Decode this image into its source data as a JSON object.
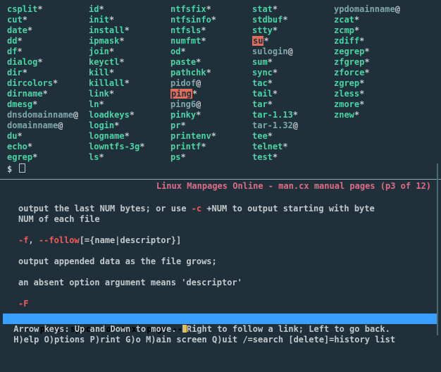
{
  "columns": [
    [
      {
        "name": "csplit",
        "suffix": "*",
        "style": "exe"
      },
      {
        "name": "cut",
        "suffix": "*",
        "style": "exe"
      },
      {
        "name": "date",
        "suffix": "*",
        "style": "exe"
      },
      {
        "name": "dd",
        "suffix": "*",
        "style": "exe"
      },
      {
        "name": "df",
        "suffix": "*",
        "style": "exe"
      },
      {
        "name": "dialog",
        "suffix": "*",
        "style": "exe"
      },
      {
        "name": "dir",
        "suffix": "*",
        "style": "exe"
      },
      {
        "name": "dircolors",
        "suffix": "*",
        "style": "exe"
      },
      {
        "name": "dirname",
        "suffix": "*",
        "style": "exe"
      },
      {
        "name": "dmesg",
        "suffix": "*",
        "style": "exe"
      },
      {
        "name": "dnsdomainname",
        "suffix": "@",
        "style": "link"
      },
      {
        "name": "domainname",
        "suffix": "@",
        "style": "link"
      },
      {
        "name": "du",
        "suffix": "*",
        "style": "exe"
      },
      {
        "name": "echo",
        "suffix": "*",
        "style": "exe"
      },
      {
        "name": "egrep",
        "suffix": "*",
        "style": "exe"
      }
    ],
    [
      {
        "name": "id",
        "suffix": "*",
        "style": "exe"
      },
      {
        "name": "init",
        "suffix": "*",
        "style": "exe"
      },
      {
        "name": "install",
        "suffix": "*",
        "style": "exe"
      },
      {
        "name": "ipmask",
        "suffix": "*",
        "style": "exe"
      },
      {
        "name": "join",
        "suffix": "*",
        "style": "exe"
      },
      {
        "name": "keyctl",
        "suffix": "*",
        "style": "exe"
      },
      {
        "name": "kill",
        "suffix": "*",
        "style": "exe"
      },
      {
        "name": "killall",
        "suffix": "*",
        "style": "exe"
      },
      {
        "name": "link",
        "suffix": "*",
        "style": "exe"
      },
      {
        "name": "ln",
        "suffix": "*",
        "style": "exe"
      },
      {
        "name": "loadkeys",
        "suffix": "*",
        "style": "exe"
      },
      {
        "name": "login",
        "suffix": "*",
        "style": "exe"
      },
      {
        "name": "logname",
        "suffix": "*",
        "style": "exe"
      },
      {
        "name": "lowntfs-3g",
        "suffix": "*",
        "style": "exe"
      },
      {
        "name": "ls",
        "suffix": "*",
        "style": "exe"
      }
    ],
    [
      {
        "name": "ntfsfix",
        "suffix": "*",
        "style": "exe"
      },
      {
        "name": "ntfsinfo",
        "suffix": "*",
        "style": "exe"
      },
      {
        "name": "ntfsls",
        "suffix": "*",
        "style": "exe"
      },
      {
        "name": "numfmt",
        "suffix": "*",
        "style": "exe"
      },
      {
        "name": "od",
        "suffix": "*",
        "style": "exe"
      },
      {
        "name": "paste",
        "suffix": "*",
        "style": "exe"
      },
      {
        "name": "pathchk",
        "suffix": "*",
        "style": "exe"
      },
      {
        "name": "pidof",
        "suffix": "@",
        "style": "link"
      },
      {
        "name": "ping",
        "suffix": "*",
        "style": "exe",
        "bg": "red"
      },
      {
        "name": "ping6",
        "suffix": "@",
        "style": "link"
      },
      {
        "name": "pinky",
        "suffix": "*",
        "style": "exe"
      },
      {
        "name": "pr",
        "suffix": "*",
        "style": "exe"
      },
      {
        "name": "printenv",
        "suffix": "*",
        "style": "exe"
      },
      {
        "name": "printf",
        "suffix": "*",
        "style": "exe"
      },
      {
        "name": "ps",
        "suffix": "*",
        "style": "exe"
      }
    ],
    [
      {
        "name": "stat",
        "suffix": "*",
        "style": "exe"
      },
      {
        "name": "stdbuf",
        "suffix": "*",
        "style": "exe"
      },
      {
        "name": "stty",
        "suffix": "*",
        "style": "exe"
      },
      {
        "name": "su",
        "suffix": "*",
        "style": "exe",
        "bg": "red"
      },
      {
        "name": "sulogin",
        "suffix": "@",
        "style": "link"
      },
      {
        "name": "sum",
        "suffix": "*",
        "style": "exe"
      },
      {
        "name": "sync",
        "suffix": "*",
        "style": "exe"
      },
      {
        "name": "tac",
        "suffix": "*",
        "style": "exe"
      },
      {
        "name": "tail",
        "suffix": "*",
        "style": "exe"
      },
      {
        "name": "tar",
        "suffix": "*",
        "style": "exe"
      },
      {
        "name": "tar-1.13",
        "suffix": "*",
        "style": "exe"
      },
      {
        "name": "tar-1.32",
        "suffix": "@",
        "style": "link"
      },
      {
        "name": "tee",
        "suffix": "*",
        "style": "exe"
      },
      {
        "name": "telnet",
        "suffix": "*",
        "style": "exe"
      },
      {
        "name": "test",
        "suffix": "*",
        "style": "exe"
      }
    ],
    [
      {
        "name": "ypdomainname",
        "suffix": "@",
        "style": "link"
      },
      {
        "name": "zcat",
        "suffix": "*",
        "style": "exe"
      },
      {
        "name": "zcmp",
        "suffix": "*",
        "style": "exe"
      },
      {
        "name": "zdiff",
        "suffix": "*",
        "style": "exe"
      },
      {
        "name": "zegrep",
        "suffix": "*",
        "style": "exe"
      },
      {
        "name": "zfgrep",
        "suffix": "*",
        "style": "exe"
      },
      {
        "name": "zforce",
        "suffix": "*",
        "style": "exe"
      },
      {
        "name": "zgrep",
        "suffix": "*",
        "style": "exe"
      },
      {
        "name": "zless",
        "suffix": "*",
        "style": "exe"
      },
      {
        "name": "zmore",
        "suffix": "*",
        "style": "exe"
      },
      {
        "name": "znew",
        "suffix": "*",
        "style": "exe"
      }
    ]
  ],
  "prompt_symbol": "$",
  "title_line": "Linux Manpages Online - man.cx manual pages (p3 of 12)",
  "man_lines": [
    {
      "type": "blank"
    },
    {
      "type": "text",
      "text": "output the last NUM bytes; or use ",
      "opt": "-c",
      "tail": " +NUM to output starting with byte"
    },
    {
      "type": "text",
      "text": "NUM of each file"
    },
    {
      "type": "blank"
    },
    {
      "type": "optline",
      "opt": "-f",
      "sep": ", ",
      "opt2": "--follow",
      "tail": "[={name|descriptor}]"
    },
    {
      "type": "blank"
    },
    {
      "type": "text",
      "text": "output appended data as the file grows;"
    },
    {
      "type": "blank"
    },
    {
      "type": "text",
      "text": "an absent option argument means 'descriptor'"
    },
    {
      "type": "blank"
    },
    {
      "type": "optline",
      "opt": "-F"
    }
  ],
  "next_page_prompt": "-- press space for next page --",
  "help_lines": [
    " Arrow keys: Up and Down to move.  Right to follow a link; Left to go back.",
    " H)elp O)ptions P)rint G)o M)ain screen Q)uit /=search [delete]=history list"
  ]
}
